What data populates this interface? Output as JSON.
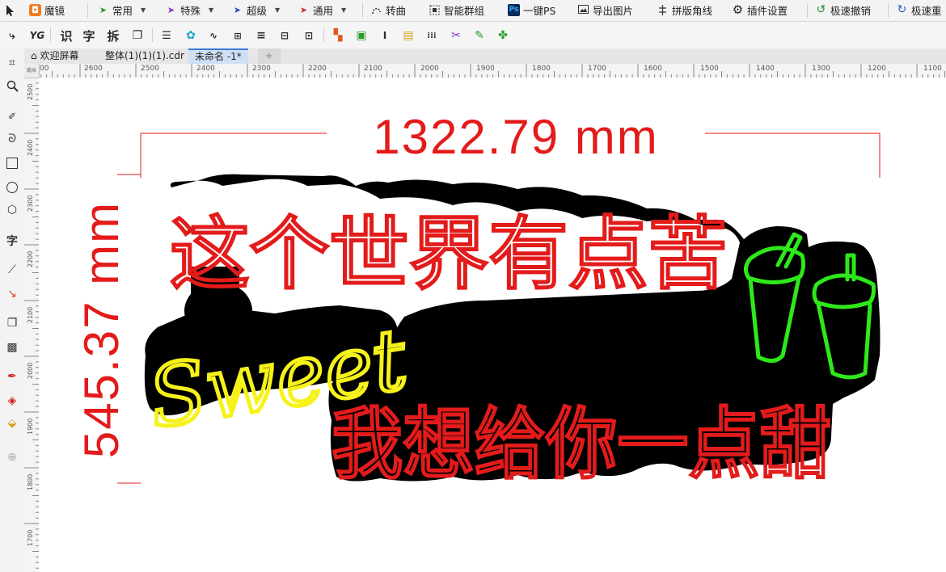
{
  "top_toolbar": {
    "items": [
      {
        "label": "魔镜",
        "icon": "magic-mirror-icon"
      },
      {
        "label": "常用",
        "icon": "paper-plane-icon"
      },
      {
        "label": "特殊",
        "icon": "paper-plane-icon"
      },
      {
        "label": "超级",
        "icon": "paper-plane-icon"
      },
      {
        "label": "通用",
        "icon": "paper-plane-icon"
      },
      {
        "label": "转曲",
        "icon": "convert-curve-icon"
      },
      {
        "label": "智能群组",
        "icon": "smart-group-icon"
      },
      {
        "label": "一键PS",
        "icon": "photoshop-icon"
      },
      {
        "label": "导出图片",
        "icon": "export-image-icon"
      },
      {
        "label": "拼版角线",
        "icon": "crop-marks-icon"
      },
      {
        "label": "插件设置",
        "icon": "gear-icon"
      },
      {
        "label": "极速撤销",
        "icon": "undo-icon"
      },
      {
        "label": "极速重",
        "icon": "redo-icon"
      }
    ],
    "ps_icon_text": "Ps"
  },
  "toolbar2": {
    "chars": [
      "识",
      "字",
      "拆"
    ],
    "logo_text": "YG"
  },
  "tabs": [
    {
      "label": "欢迎屏幕"
    },
    {
      "label": "整体(1)(1)(1).cdr"
    },
    {
      "label": "未命名 -1*"
    }
  ],
  "toolbox": {
    "text_tool": "字"
  },
  "rulers": {
    "horizontal": [
      "00",
      "2600",
      "2500",
      "2400",
      "2300",
      "2200",
      "2100",
      "2000",
      "1900",
      "1800",
      "1700",
      "1600",
      "1500",
      "1400",
      "1300",
      "1200",
      "1100"
    ],
    "vertical": [
      "2500",
      "2400",
      "2300",
      "2200",
      "2100",
      "2000",
      "1900",
      "1800",
      "1700"
    ],
    "corner": "毫米"
  },
  "design": {
    "width_dimension": "1322.79 mm",
    "height_dimension": "545.37 mm",
    "line1": "这个世界有点苦",
    "script_word": "Sweet",
    "line2": "我想给你一点甜",
    "colors": {
      "red": "#e31b1b",
      "yellow": "#f6f21a",
      "green": "#2fe81b",
      "backing": "#000000"
    }
  }
}
